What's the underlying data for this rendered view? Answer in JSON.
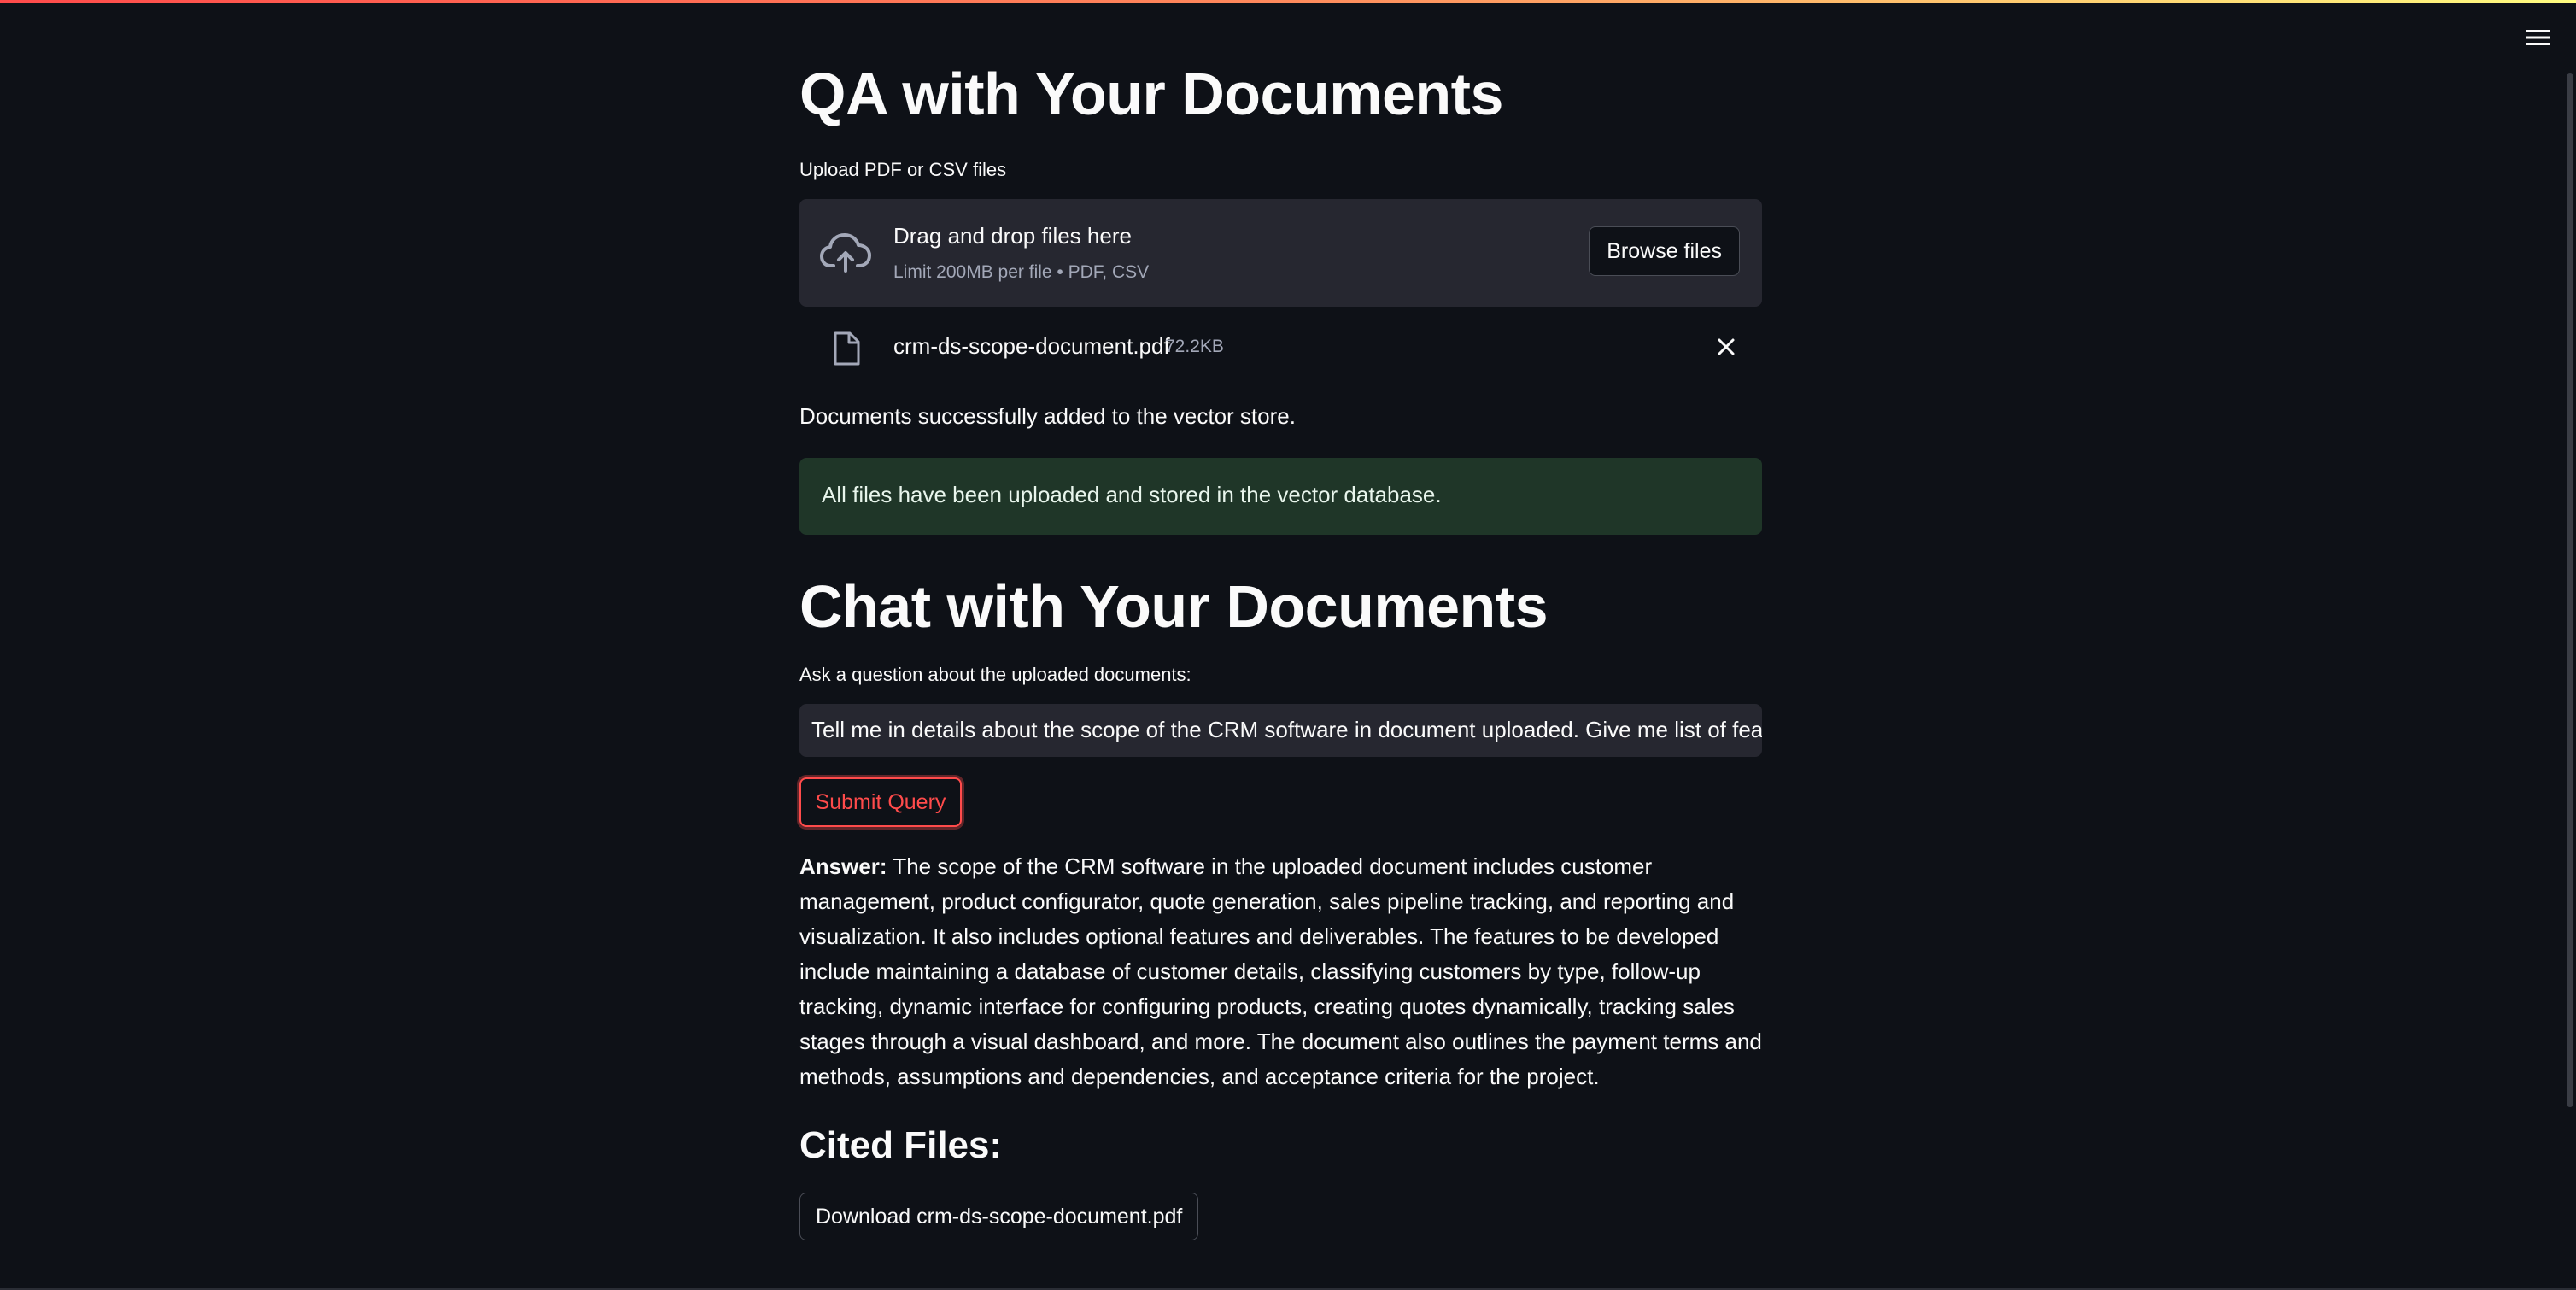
{
  "app": {
    "title": "QA with Your Documents",
    "accent_color": "#ff4b4b",
    "menu_icon": "hamburger-menu-icon"
  },
  "upload": {
    "label": "Upload PDF or CSV files",
    "dropzone_title": "Drag and drop files here",
    "dropzone_subtitle": "Limit 200MB per file • PDF, CSV",
    "browse_label": "Browse files",
    "icon": "cloud-upload-icon",
    "file": {
      "name": "crm-ds-scope-document.pdf",
      "size": "72.2KB",
      "icon": "file-icon",
      "remove_icon": "close-icon"
    },
    "status_message": "Documents successfully added to the vector store.",
    "success_message": "All files have been uploaded and stored in the vector database.",
    "success_color": "#1f3628"
  },
  "chat": {
    "title": "Chat with Your Documents",
    "question_label": "Ask a question about the uploaded documents:",
    "question_value": "Tell me in details about the scope of the CRM software in document uploaded. Give me list of features in",
    "submit_label": "Submit Query",
    "answer_label": "Answer:",
    "answer_text": "The scope of the CRM software in the uploaded document includes customer management, product configurator, quote generation, sales pipeline tracking, and reporting and visualization. It also includes optional features and deliverables. The features to be developed include maintaining a database of customer details, classifying customers by type, follow-up tracking, dynamic interface for configuring products, creating quotes dynamically, tracking sales stages through a visual dashboard, and more. The document also outlines the payment terms and methods, assumptions and dependencies, and acceptance criteria for the project."
  },
  "cited": {
    "title": "Cited Files:",
    "download_label": "Download crm-ds-scope-document.pdf"
  }
}
